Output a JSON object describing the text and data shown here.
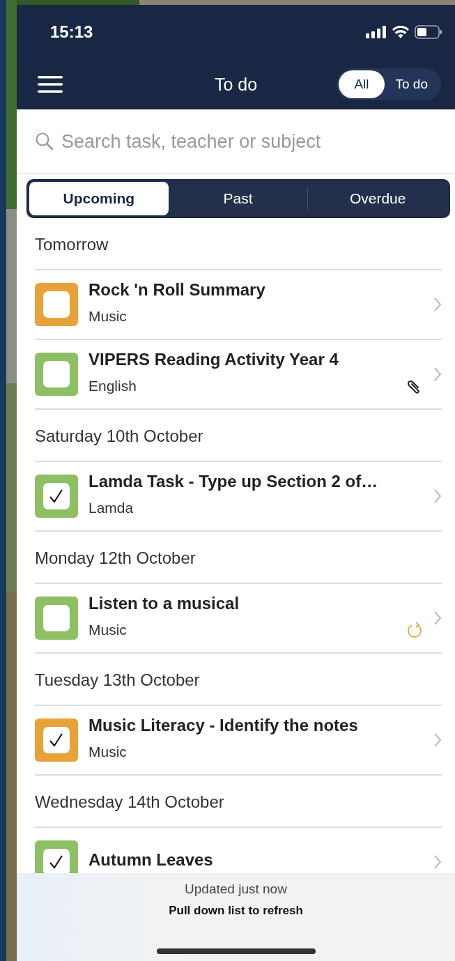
{
  "status_bar": {
    "time": "15:13"
  },
  "nav": {
    "title": "To do",
    "toggle": [
      {
        "label": "All",
        "selected": true
      },
      {
        "label": "To do",
        "selected": false
      }
    ]
  },
  "search": {
    "placeholder": "Search task, teacher or subject"
  },
  "tabs": [
    {
      "label": "Upcoming",
      "selected": true
    },
    {
      "label": "Past",
      "selected": false
    },
    {
      "label": "Overdue",
      "selected": false
    }
  ],
  "sections": [
    {
      "heading": "Tomorrow",
      "tasks": [
        {
          "title": "Rock 'n Roll Summary",
          "subject": "Music",
          "color": "#e8a23a",
          "checked": false
        },
        {
          "title": "VIPERS Reading Activity Year 4",
          "subject": "English",
          "color": "#8cc063",
          "checked": false,
          "attachment": true
        }
      ]
    },
    {
      "heading": "Saturday 10th October",
      "tasks": [
        {
          "title": "Lamda Task - Type up Section 2 of…",
          "subject": "Lamda",
          "color": "#8cc063",
          "checked": true
        }
      ]
    },
    {
      "heading": "Monday 12th October",
      "tasks": [
        {
          "title": "Listen to a musical",
          "subject": "Music",
          "color": "#8cc063",
          "checked": false,
          "repeating": true
        }
      ]
    },
    {
      "heading": "Tuesday 13th October",
      "tasks": [
        {
          "title": "Music Literacy - Identify the notes",
          "subject": "Music",
          "color": "#e8a23a",
          "checked": true
        }
      ]
    },
    {
      "heading": "Wednesday 14th October",
      "tasks": [
        {
          "title": "Autumn Leaves",
          "color": "#8cc063",
          "checked": true
        }
      ]
    }
  ],
  "footer": {
    "updated": "Updated just now",
    "hint": "Pull down list to refresh"
  }
}
